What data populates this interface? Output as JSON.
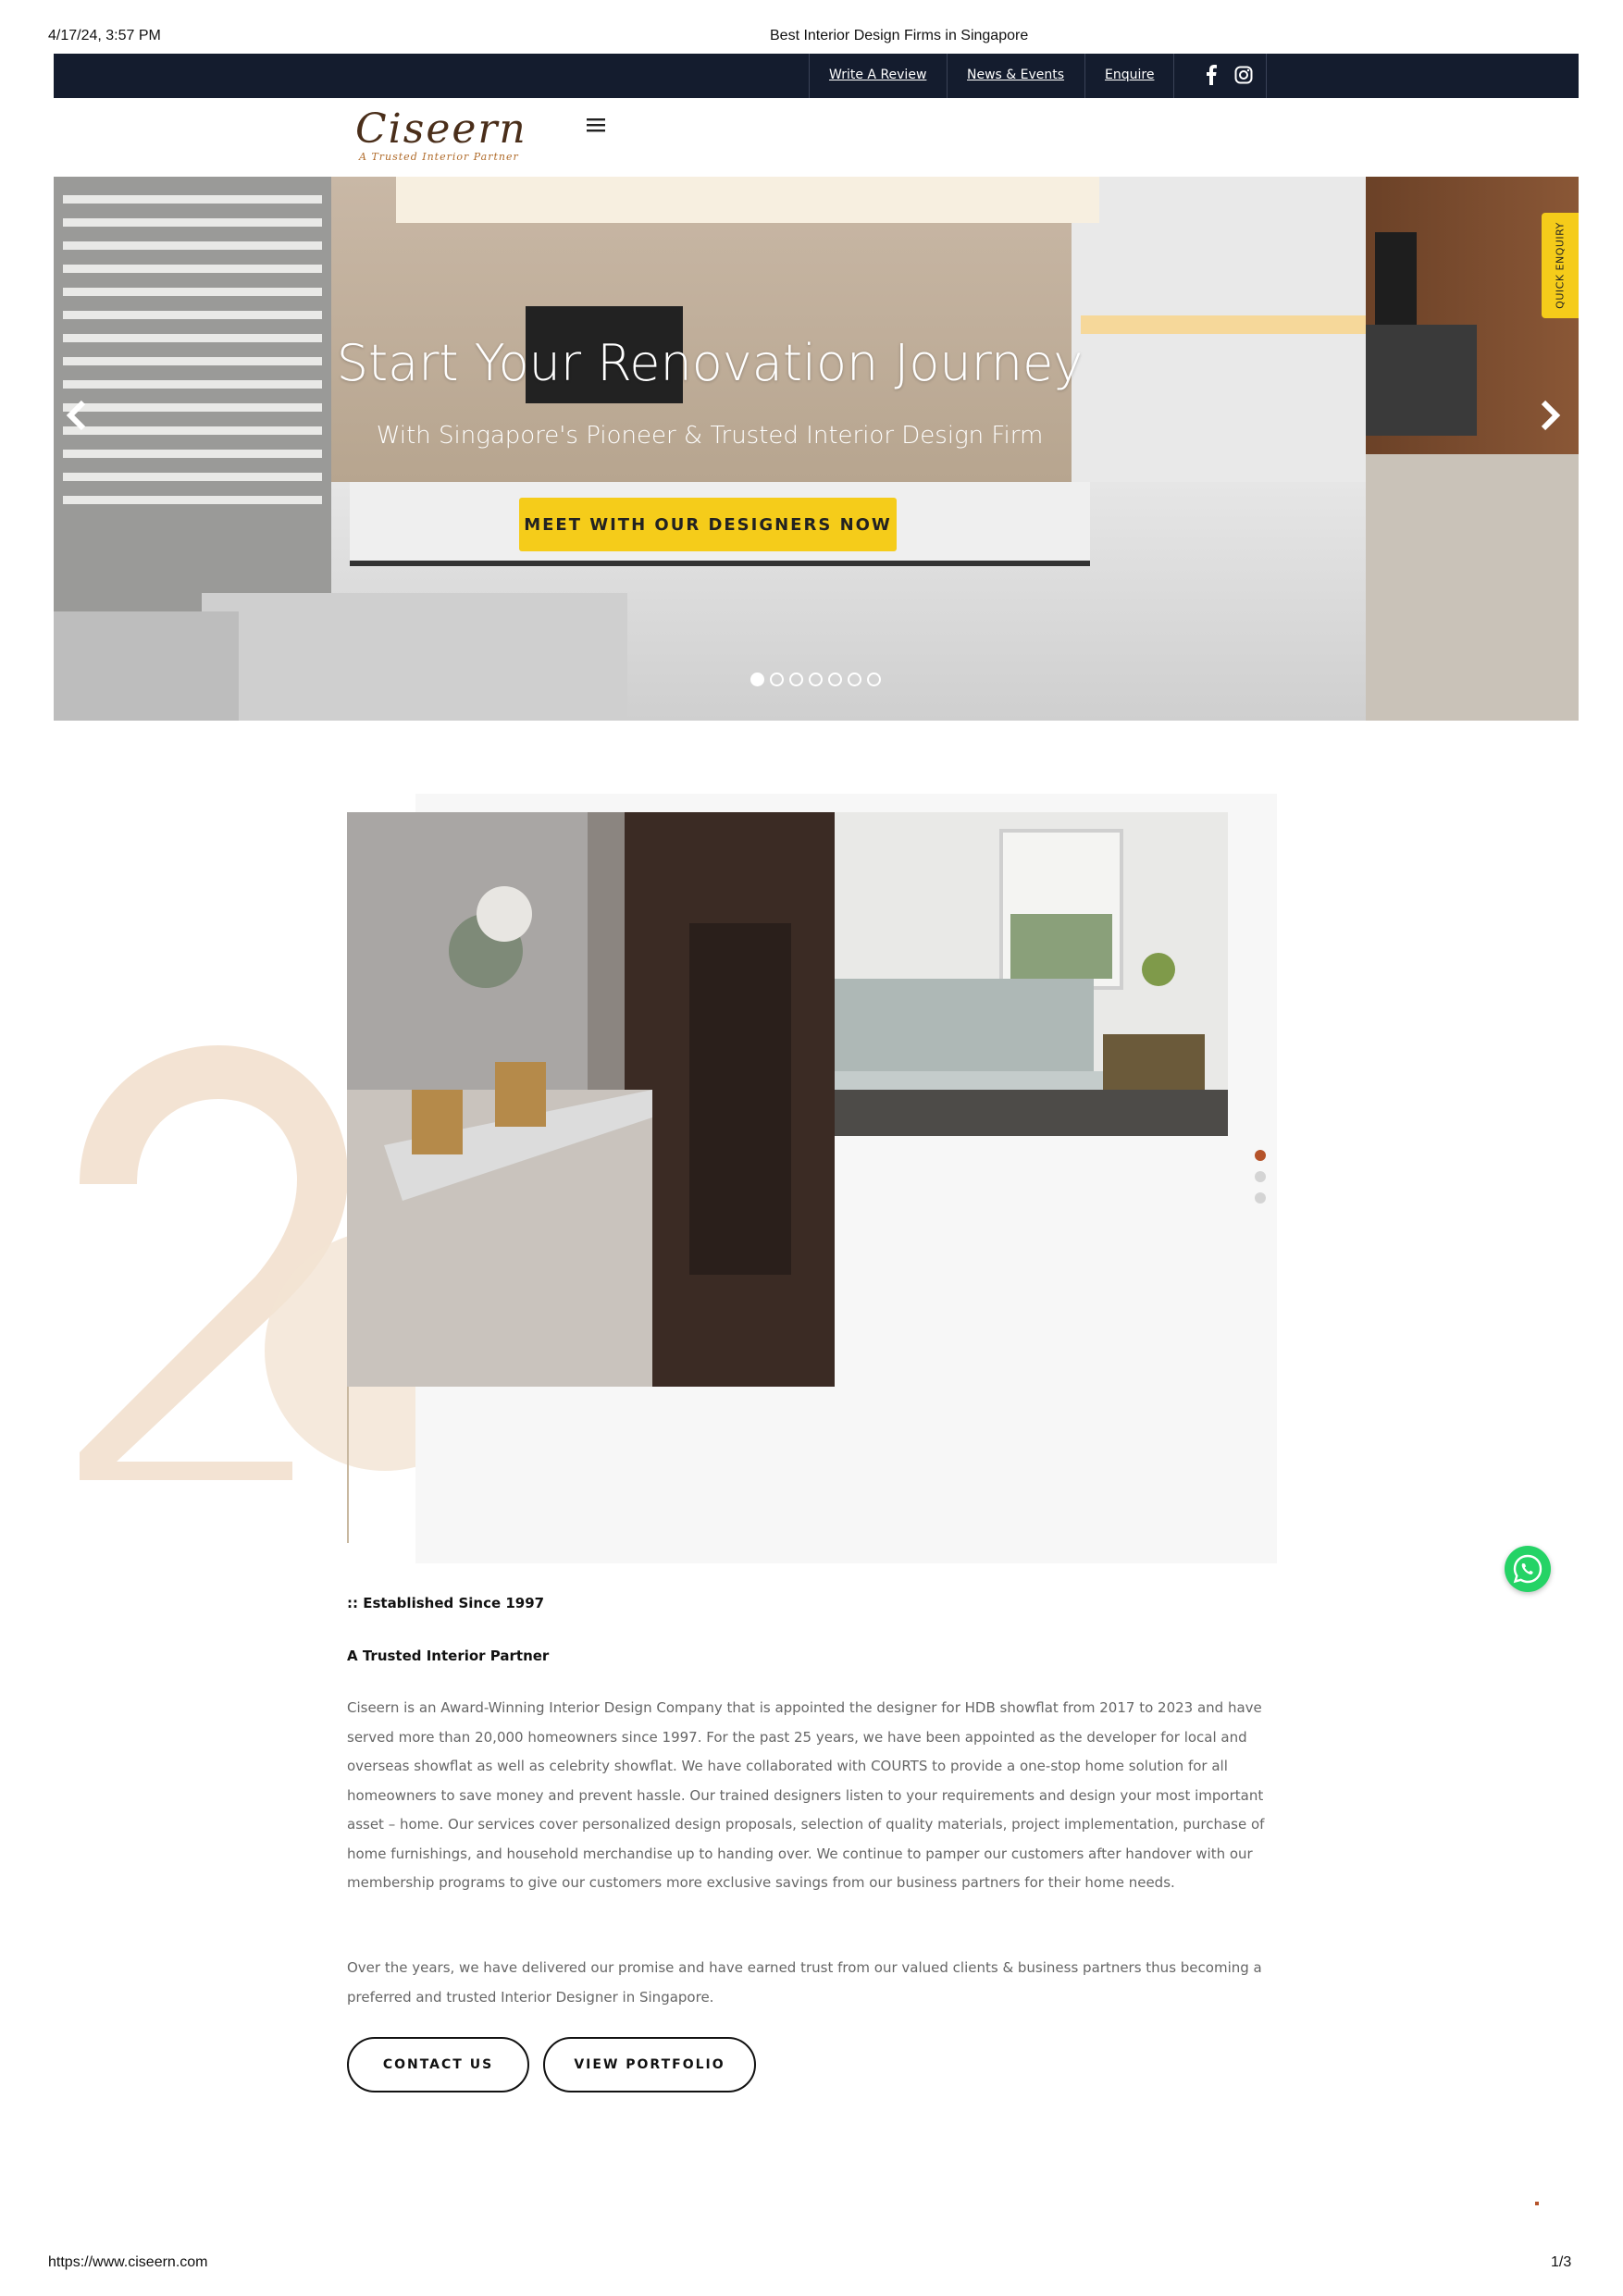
{
  "print_header": {
    "datetime": "4/17/24, 3:57 PM",
    "title": "Best Interior Design Firms in Singapore"
  },
  "print_footer": {
    "url": "https://www.ciseern.com",
    "page": "1/3"
  },
  "topbar": {
    "links": [
      "Write A Review",
      "News & Events",
      "Enquire"
    ],
    "social": [
      "facebook-icon",
      "instagram-icon"
    ]
  },
  "logo": {
    "name": "Ciseern",
    "tagline": "A Trusted Interior Partner"
  },
  "hero": {
    "title": "Start Your Renovation Journey",
    "subtitle": "With Singapore's Pioneer & Trusted Interior Design Firm",
    "cta": "MEET WITH OUR DESIGNERS NOW",
    "slide_count": 7,
    "active_slide": 1
  },
  "quick_enquiry": "QUICK ENQUIRY",
  "about": {
    "established": ":: Established Since 1997",
    "tagline": "A Trusted Interior Partner",
    "paragraph1": "Ciseern is an Award-Winning Interior Design Company that is appointed the designer for HDB showflat from 2017 to 2023 and have served more than 20,000 homeowners since 1997. For the past 25 years, we have been appointed as the developer for local and overseas showflat as well as celebrity showflat. We have collaborated with COURTS to provide a one-stop home solution for all homeowners to save money and prevent hassle. Our trained designers listen to your requirements and design your most important asset – home. Our services cover personalized design proposals, selection of quality materials, project implementation, purchase of home furnishings, and household merchandise up to handing over. We continue to pamper our customers after handover with our membership programs to give our customers more exclusive savings from our business partners for their home needs.",
    "paragraph2": "Over the years, we have delivered our promise and have earned trust from our valued clients & business partners thus becoming a preferred and trusted Interior Designer in Singapore.",
    "buttons": [
      "CONTACT US",
      "VIEW PORTFOLIO"
    ]
  },
  "colors": {
    "topbar": "#141c2e",
    "accent_yellow": "#f5cc1a",
    "accent_brown": "#b5532a",
    "whatsapp": "#25d366"
  }
}
